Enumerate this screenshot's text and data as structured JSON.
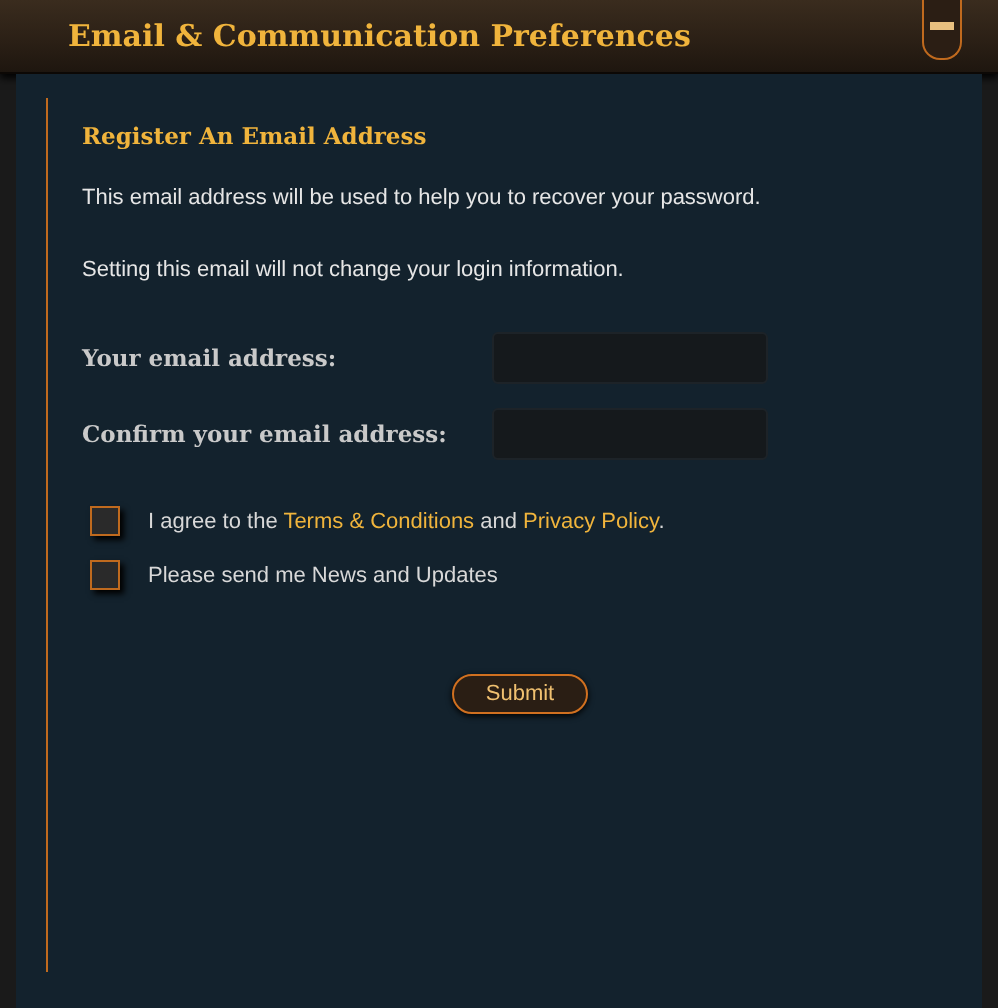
{
  "window": {
    "title": "Email & Communication Preferences"
  },
  "section": {
    "title": "Register An Email Address",
    "notes": [
      "This email address will be used to help you to recover your password.",
      "Setting this email will not change your login information."
    ]
  },
  "fields": [
    {
      "label": "Your email address:"
    },
    {
      "label": "Confirm your email address:"
    }
  ],
  "options": [
    {
      "kind": "agreement",
      "parts": [
        "I agree to the ",
        "Terms & Conditions",
        " and ",
        "Privacy Policy",
        "."
      ],
      "checked": false
    },
    {
      "kind": "plain",
      "text": "Please send me News and Updates",
      "checked": false
    }
  ],
  "submit": "Submit"
}
